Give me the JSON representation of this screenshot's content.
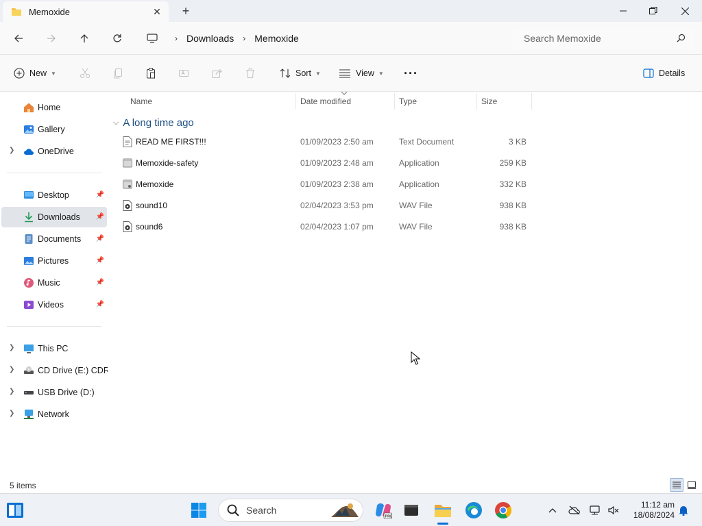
{
  "window": {
    "tab_title": "Memoxide",
    "close_tab_glyph": "✕",
    "new_tab_glyph": "+"
  },
  "address": {
    "breadcrumbs": [
      "Downloads",
      "Memoxide"
    ],
    "search_placeholder": "Search Memoxide"
  },
  "commands": {
    "new_label": "New",
    "sort_label": "Sort",
    "view_label": "View",
    "more_glyph": "···",
    "details_label": "Details"
  },
  "sidebar": {
    "items": [
      {
        "label": "Home",
        "icon": "home-icon"
      },
      {
        "label": "Gallery",
        "icon": "gallery-icon"
      },
      {
        "label": "OneDrive",
        "icon": "cloud-icon"
      },
      {
        "label": "Desktop",
        "icon": "desktop-icon"
      },
      {
        "label": "Downloads",
        "icon": "download-icon"
      },
      {
        "label": "Documents",
        "icon": "documents-icon"
      },
      {
        "label": "Pictures",
        "icon": "pictures-icon"
      },
      {
        "label": "Music",
        "icon": "music-icon"
      },
      {
        "label": "Videos",
        "icon": "videos-icon"
      },
      {
        "label": "This PC",
        "icon": "pc-icon"
      },
      {
        "label": "CD Drive (E:) CDRO",
        "icon": "cd-drive-icon"
      },
      {
        "label": "USB Drive (D:)",
        "icon": "usb-drive-icon"
      },
      {
        "label": "Network",
        "icon": "network-icon"
      }
    ]
  },
  "columns": {
    "name": "Name",
    "date": "Date modified",
    "type": "Type",
    "size": "Size"
  },
  "group_label": "A long time ago",
  "files": [
    {
      "name": "READ ME FIRST!!!",
      "date": "01/09/2023 2:50 am",
      "type": "Text Document",
      "size": "3 KB",
      "icon": "text-file-icon"
    },
    {
      "name": "Memoxide-safety",
      "date": "01/09/2023 2:48 am",
      "type": "Application",
      "size": "259 KB",
      "icon": "application-icon"
    },
    {
      "name": "Memoxide",
      "date": "01/09/2023 2:38 am",
      "type": "Application",
      "size": "332 KB",
      "icon": "application-icon"
    },
    {
      "name": "sound10",
      "date": "02/04/2023 3:53 pm",
      "type": "WAV File",
      "size": "938 KB",
      "icon": "audio-file-icon"
    },
    {
      "name": "sound6",
      "date": "02/04/2023 1:07 pm",
      "type": "WAV File",
      "size": "938 KB",
      "icon": "audio-file-icon"
    }
  ],
  "status": {
    "item_count": "5 items"
  },
  "taskbar": {
    "search_label": "Search",
    "time": "11:12 am",
    "date": "18/08/2024"
  },
  "colors": {
    "accent": "#0a6ed1",
    "folder": "#f4c542",
    "selected": "#e1e4e9"
  }
}
